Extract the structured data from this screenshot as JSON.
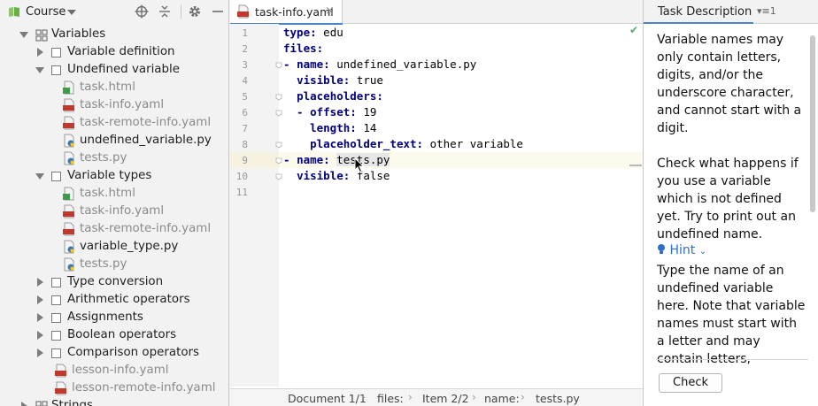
{
  "project_panel": {
    "title": "Course",
    "tree": [
      {
        "label": "Variables",
        "kind": "lesson",
        "expanded": true
      },
      {
        "label": "Variable definition",
        "kind": "task",
        "expanded": false
      },
      {
        "label": "Undefined variable",
        "kind": "task",
        "expanded": true
      },
      {
        "label": "task.html",
        "kind": "html",
        "grey": true
      },
      {
        "label": "task-info.yaml",
        "kind": "yaml",
        "grey": true
      },
      {
        "label": "task-remote-info.yaml",
        "kind": "yaml",
        "grey": true
      },
      {
        "label": "undefined_variable.py",
        "kind": "py",
        "grey": false
      },
      {
        "label": "tests.py",
        "kind": "py",
        "grey": true
      },
      {
        "label": "Variable types",
        "kind": "task",
        "expanded": true
      },
      {
        "label": "task.html",
        "kind": "html",
        "grey": true
      },
      {
        "label": "task-info.yaml",
        "kind": "yaml",
        "grey": true
      },
      {
        "label": "task-remote-info.yaml",
        "kind": "yaml",
        "grey": true
      },
      {
        "label": "variable_type.py",
        "kind": "py",
        "grey": false
      },
      {
        "label": "tests.py",
        "kind": "py",
        "grey": true
      },
      {
        "label": "Type conversion",
        "kind": "task",
        "expanded": false
      },
      {
        "label": "Arithmetic operators",
        "kind": "task",
        "expanded": false
      },
      {
        "label": "Assignments",
        "kind": "task",
        "expanded": false
      },
      {
        "label": "Boolean operators",
        "kind": "task",
        "expanded": false
      },
      {
        "label": "Comparison operators",
        "kind": "task",
        "expanded": false
      },
      {
        "label": "lesson-info.yaml",
        "kind": "yaml",
        "grey": true
      },
      {
        "label": "lesson-remote-info.yaml",
        "kind": "yaml",
        "grey": true
      },
      {
        "label": "Strings",
        "kind": "lesson",
        "expanded": false
      }
    ]
  },
  "editor": {
    "tab_label": "task-info.yaml",
    "tab_close": "×",
    "line_numbers": [
      "1",
      "2",
      "3",
      "4",
      "5",
      "6",
      "7",
      "8",
      "9",
      "10",
      "11"
    ],
    "lines": [
      {
        "prefix": "",
        "key": "type",
        "sep": ": ",
        "value": "edu"
      },
      {
        "prefix": "",
        "key": "files",
        "sep": ":",
        "value": ""
      },
      {
        "prefix": "- ",
        "key": "name",
        "sep": ": ",
        "value": "undefined_variable.py"
      },
      {
        "prefix": "  ",
        "key": "visible",
        "sep": ": ",
        "value": "true"
      },
      {
        "prefix": "  ",
        "key": "placeholders",
        "sep": ":",
        "value": ""
      },
      {
        "prefix": "  - ",
        "key": "offset",
        "sep": ": ",
        "value": "19"
      },
      {
        "prefix": "    ",
        "key": "length",
        "sep": ": ",
        "value": "14"
      },
      {
        "prefix": "    ",
        "key": "placeholder_text",
        "sep": ": ",
        "value": "other variable"
      },
      {
        "prefix": "- ",
        "key": "name",
        "sep": ": ",
        "value": "tests.py"
      },
      {
        "prefix": "  ",
        "key": "visible",
        "sep": ": ",
        "value": "false"
      },
      {
        "prefix": "",
        "key": "",
        "sep": "",
        "value": ""
      }
    ],
    "breadcrumbs": [
      "Document 1/1",
      "files:",
      "Item 2/2",
      "name:",
      "tests.py"
    ]
  },
  "task_panel": {
    "title": "Task Description",
    "menu": "▾≡1",
    "paragraph1": "Variable names may only contain letters, digits, and/or the underscore character, and cannot start with a digit.",
    "paragraph2": "Check what happens if you use a variable which is not defined yet. Try to print out an undefined name.",
    "hint_label": "Hint",
    "hint_text": "Type the name of an undefined variable here. Note that variable names must start with a letter and may contain letters,",
    "check_button": "Check"
  },
  "colors": {
    "accent": "#4a86c7",
    "yaml_key": "#000080",
    "hint": "#2e6fc9"
  }
}
